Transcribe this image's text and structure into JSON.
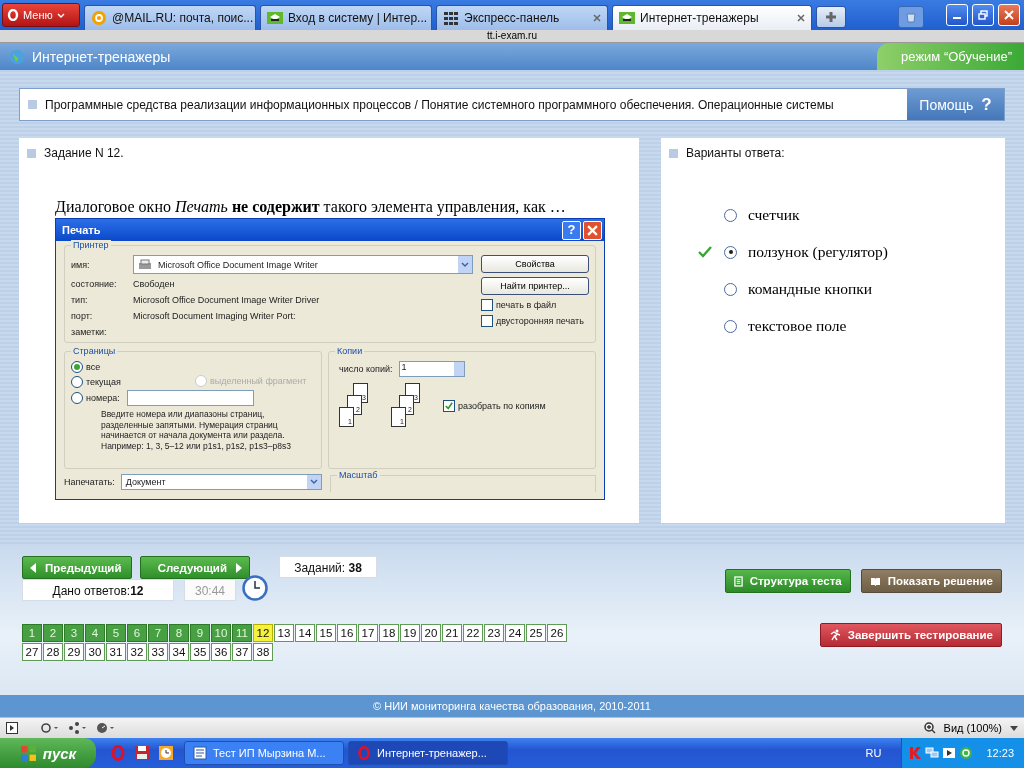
{
  "browser": {
    "menu_label": "Меню",
    "tabs": [
      {
        "label": "@MAIL.RU: почта, поис...",
        "kind": "mail",
        "selected": false
      },
      {
        "label": "Вход в систему | Интер...",
        "kind": "site",
        "selected": false
      },
      {
        "label": "Экспресс-панель",
        "kind": "speeddial",
        "selected": false
      },
      {
        "label": "Интернет-тренажеры",
        "kind": "site",
        "selected": true
      }
    ],
    "address": "tt.i-exam.ru"
  },
  "header": {
    "title": "Интернет-тренажеры",
    "mode": "режим “Обучение”"
  },
  "topic": {
    "text": "Программные средства реализации информационных процессов / Понятие системного программного обеспечения. Операционные системы",
    "help": "Помощь",
    "help_glyph": "?"
  },
  "task": {
    "title": "Задание N 12.",
    "question": "Диалоговое окно *Печать* **не содержит** такого элемента управления, как …",
    "dialog": {
      "title": "Печать",
      "help_glyph": "?",
      "printer": {
        "legend": "Принтер",
        "rows": [
          {
            "label": "имя:",
            "value": "Microsoft Office Document Image Writer",
            "kind": "select"
          },
          {
            "label": "состояние:",
            "value": "Свободен",
            "kind": "text"
          },
          {
            "label": "тип:",
            "value": "Microsoft Office Document Image Writer Driver",
            "kind": "text"
          },
          {
            "label": "порт:",
            "value": "Microsoft Document Imaging Writer Port:",
            "kind": "text"
          },
          {
            "label": "заметки:",
            "kind": "text"
          }
        ],
        "buttons": [
          "Свойства",
          "Найти принтер..."
        ],
        "checkboxes": [
          {
            "label": "печать в файл",
            "checked": false
          },
          {
            "label": "двусторонняя печать",
            "checked": false
          }
        ]
      },
      "pages": {
        "legend": "Страницы",
        "radios": [
          {
            "label": "все",
            "selected": true,
            "disabled": false,
            "kind": "plain"
          },
          {
            "label": "текущая",
            "selected": false,
            "disabled": false,
            "kind": "plain"
          },
          {
            "label": "выделенный фрагмент",
            "selected": false,
            "disabled": true,
            "kind": "plain"
          },
          {
            "label": "номера:",
            "selected": false,
            "disabled": false,
            "kind": "field"
          }
        ],
        "hint": "Введите номера или диапазоны страниц, разделенные запятыми. Нумерация страниц начинается от начала документа или раздела. Например: 1, 3, 5–12 или p1s1, p1s2, p1s3–p8s3"
      },
      "copies": {
        "legend": "Копии",
        "count_label": "число копий:",
        "count": "1",
        "stacks": [
          [
            "3",
            "2",
            "1"
          ],
          [
            "3",
            "2",
            "1"
          ]
        ],
        "collate": {
          "label": "разобрать по копиям",
          "checked": true
        }
      },
      "print_what": {
        "label": "Напечатать:",
        "value": "Документ"
      },
      "scale": {
        "legend": "Масштаб"
      }
    }
  },
  "answers": {
    "title": "Варианты ответа:",
    "options": [
      {
        "label": "счетчик",
        "selected": false,
        "correct": false
      },
      {
        "label": "ползунок (регулятор)",
        "selected": true,
        "correct": true
      },
      {
        "label": "командные кнопки",
        "selected": false,
        "correct": false
      },
      {
        "label": "текстовое поле",
        "selected": false,
        "correct": false
      }
    ]
  },
  "nav": {
    "prev": "Предыдущий",
    "next": "Следующий",
    "tasks_label": "Заданий:",
    "tasks_count": "38",
    "answered_label": "Дано ответов:",
    "answered_count": "12",
    "timer": "30:44",
    "structure": "Структура теста",
    "solution": "Показать решение",
    "finish": "Завершить тестирование",
    "numbers": [
      {
        "label": "1",
        "kind": "answered"
      },
      {
        "label": "2",
        "kind": "answered"
      },
      {
        "label": "3",
        "kind": "answered"
      },
      {
        "label": "4",
        "kind": "answered"
      },
      {
        "label": "5",
        "kind": "answered"
      },
      {
        "label": "6",
        "kind": "answered"
      },
      {
        "label": "7",
        "kind": "answered"
      },
      {
        "label": "8",
        "kind": "answered"
      },
      {
        "label": "9",
        "kind": "answered"
      },
      {
        "label": "10",
        "kind": "answered"
      },
      {
        "label": "11",
        "kind": "answered"
      },
      {
        "label": "12",
        "kind": "current"
      },
      {
        "label": "13",
        "kind": "open"
      },
      {
        "label": "14",
        "kind": "open"
      },
      {
        "label": "15",
        "kind": "open"
      },
      {
        "label": "16",
        "kind": "open"
      },
      {
        "label": "17",
        "kind": "open"
      },
      {
        "label": "18",
        "kind": "open"
      },
      {
        "label": "19",
        "kind": "open"
      },
      {
        "label": "20",
        "kind": "open"
      },
      {
        "label": "21",
        "kind": "open"
      },
      {
        "label": "22",
        "kind": "open"
      },
      {
        "label": "23",
        "kind": "open"
      },
      {
        "label": "24",
        "kind": "open"
      },
      {
        "label": "25",
        "kind": "open"
      },
      {
        "label": "26",
        "kind": "open"
      },
      {
        "label": "27",
        "kind": "open"
      },
      {
        "label": "28",
        "kind": "open"
      },
      {
        "label": "29",
        "kind": "open"
      },
      {
        "label": "30",
        "kind": "open"
      },
      {
        "label": "31",
        "kind": "open"
      },
      {
        "label": "32",
        "kind": "open"
      },
      {
        "label": "33",
        "kind": "open"
      },
      {
        "label": "34",
        "kind": "open"
      },
      {
        "label": "35",
        "kind": "open"
      },
      {
        "label": "36",
        "kind": "open"
      },
      {
        "label": "37",
        "kind": "open"
      },
      {
        "label": "38",
        "kind": "open"
      }
    ]
  },
  "footer": {
    "copyright": "© НИИ мониторинга качества образования, 2010-2011"
  },
  "status_bar": {
    "zoom": "Вид (100%)"
  },
  "taskbar": {
    "start": "пуск",
    "windows": [
      {
        "label": "Тест ИП Мырзина М...",
        "kind": "doc",
        "selected": false
      },
      {
        "label": "Интернет-тренажер...",
        "kind": "opera",
        "selected": true
      }
    ],
    "lang": "RU",
    "clock": "12:23"
  }
}
